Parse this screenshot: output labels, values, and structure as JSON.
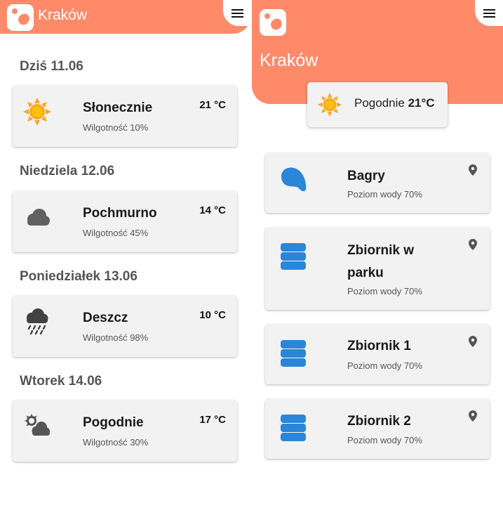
{
  "left": {
    "header": {
      "app_name": "Kraków",
      "logo_icon": "image-logo-icon",
      "menu_icon": "menu-icon"
    },
    "days": [
      {
        "heading": "Dziś 11.06",
        "condition": "Słonecznie",
        "humidity": "Wilgotność 10%",
        "temperature": "21 °C",
        "icon": "sun-icon"
      },
      {
        "heading": "Niedziela 12.06",
        "condition": "Pochmurno",
        "humidity": "Wilgotność 45%",
        "temperature": "14 °C",
        "icon": "cloud-icon"
      },
      {
        "heading": "Poniedziałek 13.06",
        "condition": "Deszcz",
        "humidity": "Wilgotność 98%",
        "temperature": "10 °C",
        "icon": "rain-icon"
      },
      {
        "heading": "Wtorek 14.06",
        "condition": "Pogodnie",
        "humidity": "Wilgotność 30%",
        "temperature": "17 °C",
        "icon": "partly-cloudy-icon"
      }
    ]
  },
  "right": {
    "header": {
      "city": "Kraków",
      "logo_icon": "image-logo-icon",
      "menu_icon": "menu-icon"
    },
    "summary": {
      "condition": "Pogodnie",
      "temperature": "21°C",
      "icon": "sun-icon"
    },
    "sites": [
      {
        "name": "Bagry",
        "level": "Poziom wody 70%",
        "icon": "lake-icon"
      },
      {
        "name": "Zbiornik w parku",
        "level": "Poziom wody 70%",
        "icon": "tank-icon"
      },
      {
        "name": "Zbiornik 1",
        "level": "Poziom wody 70%",
        "icon": "tank-icon"
      },
      {
        "name": "Zbiornik 2",
        "level": "Poziom wody 70%",
        "icon": "tank-icon"
      }
    ],
    "pin_icon": "location-pin-icon"
  },
  "colors": {
    "accent": "#ff8a6a",
    "card_bg": "#f2f2f2",
    "sun": "#f9a825",
    "water": "#2a86d8",
    "cloud": "#616161"
  }
}
